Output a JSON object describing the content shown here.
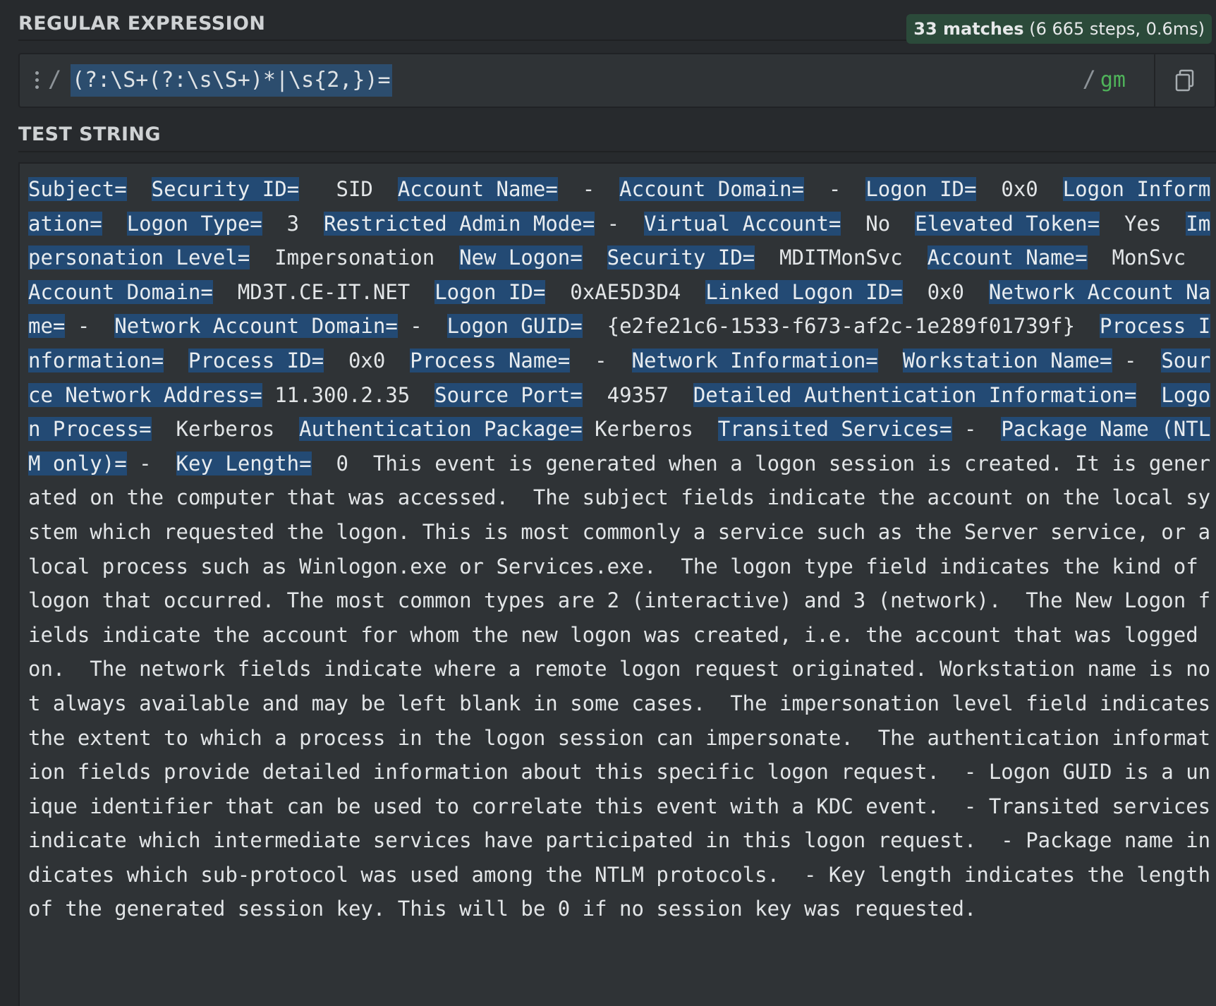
{
  "regex_section": {
    "title": "REGULAR EXPRESSION",
    "match_count": "33 matches",
    "match_info": "(6 665 steps, 0.6ms)",
    "delimiter_open": "/",
    "pattern": "(?:\\S+(?:\\s\\S+)*|\\s{2,})=",
    "delimiter_close": "/",
    "flags": "gm",
    "icons": [
      "drag-handle-icon",
      "copy-icon"
    ]
  },
  "test_section": {
    "title": "TEST STRING",
    "text": "Subject=  Security ID=   SID  Account Name=  -  Account Domain=  -  Logon ID=  0x0  Logon Information=  Logon Type=  3  Restricted Admin Mode= -  Virtual Account=  No  Elevated Token=  Yes  Impersonation Level=  Impersonation  New Logon=  Security ID=  MDITMonSvc  Account Name=  MonSvc  Account Domain=  MD3T.CE-IT.NET  Logon ID=  0xAE5D3D4  Linked Logon ID=  0x0  Network Account Name= -  Network Account Domain= -  Logon GUID=  {e2fe21c6-1533-f673-af2c-1e289f01739f}  Process Information=  Process ID=  0x0  Process Name=  -  Network Information=  Workstation Name= -  Source Network Address= 11.300.2.35  Source Port=  49357  Detailed Authentication Information=  Logon Process=  Kerberos  Authentication Package= Kerberos  Transited Services= -  Package Name (NTLM only)= -  Key Length=  0  This event is generated when a logon session is created. It is generated on the computer that was accessed.  The subject fields indicate the account on the local system which requested the logon. This is most commonly a service such as the Server service, or a local process such as Winlogon.exe or Services.exe.  The logon type field indicates the kind of logon that occurred. The most common types are 2 (interactive) and 3 (network).  The New Logon fields indicate the account for whom the new logon was created, i.e. the account that was logged on.  The network fields indicate where a remote logon request originated. Workstation name is not always available and may be left blank in some cases.  The impersonation level field indicates the extent to which a process in the logon session can impersonate.  The authentication information fields provide detailed information about this specific logon request.  - Logon GUID is a unique identifier that can be used to correlate this event with a KDC event.  - Transited services indicate which intermediate services have participated in this logon request.  - Package name indicates which sub-protocol was used among the NTLM protocols.  - Key length indicates the length of the generated session key. This will be 0 if no session key was requested."
  }
}
